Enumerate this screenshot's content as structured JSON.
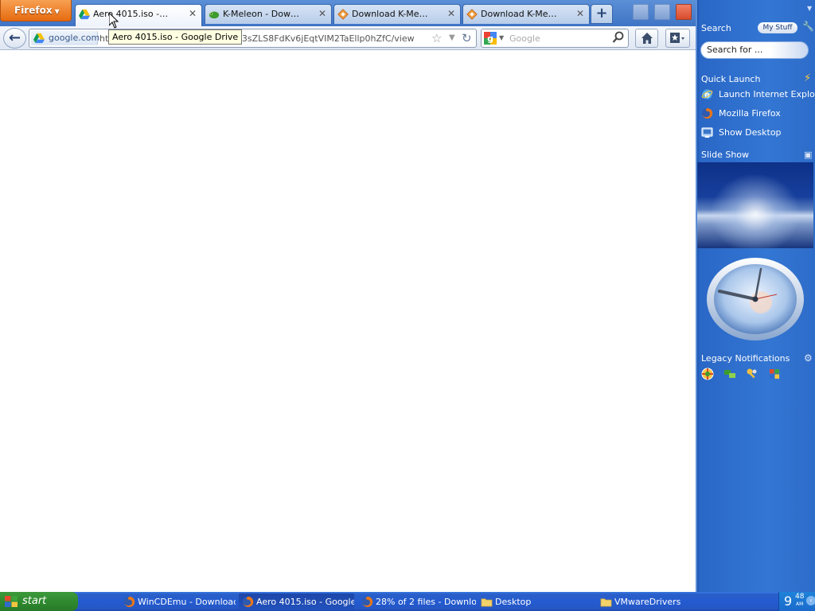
{
  "browser": {
    "menu_button": "Firefox",
    "tabs": [
      {
        "label": "Aero 4015.iso - Google...",
        "icon": "google-drive-icon",
        "active": true
      },
      {
        "label": "K-Meleon - Downloads...",
        "icon": "k-meleon-icon",
        "active": false
      },
      {
        "label": "Download K-Meleon fr...",
        "icon": "download-site-icon",
        "active": false
      },
      {
        "label": "Download K-Meleon fr...",
        "icon": "download-site-icon",
        "active": false
      }
    ],
    "new_tab": "+",
    "identity_domain": "google.com",
    "url": "https://docs.google.com/file/d/0B4PYG7kK3sZLS8FdKv6jEqtVIM2TaEllp0hZfC/view",
    "url_visible": "ht",
    "url_visible_tail": "kK3sZLS8FdKv6jEqtVIM2TaEllp0hZfC/view",
    "search_placeholder": "Google",
    "tooltip": "Aero 4015.iso - Google Drive"
  },
  "sidebar": {
    "search_title": "Search",
    "my_stuff": "My Stuff",
    "search_box": "Search for ...",
    "quick_launch_title": "Quick Launch",
    "quick_launch": [
      {
        "label": "Launch Internet Explorer",
        "icon": "internet-explorer-icon"
      },
      {
        "label": "Mozilla Firefox",
        "icon": "firefox-icon"
      },
      {
        "label": "Show Desktop",
        "icon": "show-desktop-icon"
      }
    ],
    "slideshow_title": "Slide Show",
    "legacy_title": "Legacy Notifications"
  },
  "taskbar": {
    "start": "start",
    "tasks": [
      {
        "label": "WinCDEmu - Download",
        "icon": "firefox-icon",
        "active": false
      },
      {
        "label": "Aero 4015.iso - Google",
        "icon": "firefox-icon",
        "active": true
      },
      {
        "label": "28% of 2 files - Downloa",
        "icon": "firefox-icon",
        "active": false
      },
      {
        "label": "Desktop",
        "icon": "folder-icon",
        "active": false
      },
      {
        "label": "VMwareDrivers",
        "icon": "folder-icon",
        "active": false
      }
    ],
    "clock_hour": "9",
    "clock_minute": "48",
    "clock_ampm": "AM"
  },
  "colors": {
    "sidebar_blue": "#3376d3",
    "taskbar_blue": "#245bd0",
    "firefox_orange": "#e66b10",
    "tooltip_bg": "#ffffe1"
  }
}
